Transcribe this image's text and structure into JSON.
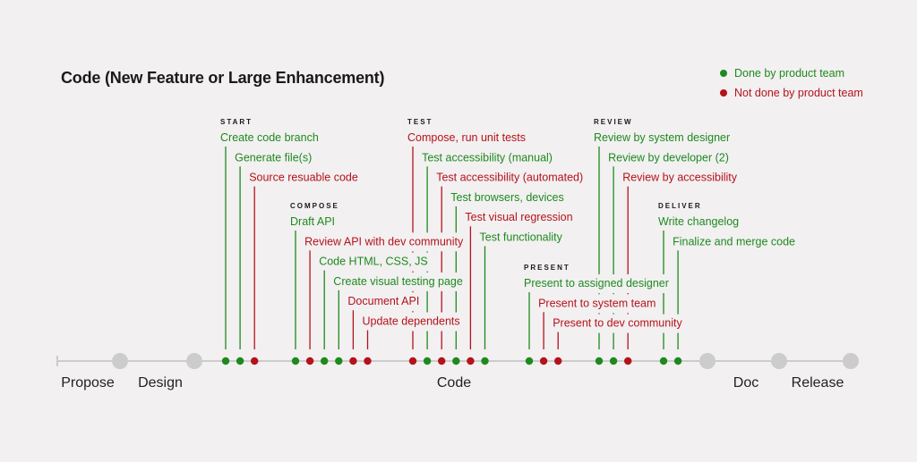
{
  "title": "Code (New Feature or Large Enhancement)",
  "colors": {
    "done": "#1e8a1e",
    "not_done": "#b5121b",
    "stage": "#cccccc",
    "axis": "#cccccc",
    "background": "#f2f0f1"
  },
  "legend": [
    {
      "label": "Done by product team",
      "status": "done"
    },
    {
      "label": "Not done by product team",
      "status": "not_done"
    }
  ],
  "stages": [
    {
      "label": "Propose"
    },
    {
      "label": "Design"
    },
    {
      "label": "Code"
    },
    {
      "label": "Doc"
    },
    {
      "label": "Release"
    }
  ],
  "phases": [
    {
      "name": "START",
      "steps": [
        {
          "label": "Create code branch",
          "status": "done"
        },
        {
          "label": "Generate file(s)",
          "status": "done"
        },
        {
          "label": "Source resuable code",
          "status": "not_done"
        }
      ]
    },
    {
      "name": "COMPOSE",
      "steps": [
        {
          "label": "Draft API",
          "status": "done"
        },
        {
          "label": "Review API with dev community",
          "status": "not_done"
        },
        {
          "label": "Code HTML, CSS, JS",
          "status": "done"
        },
        {
          "label": "Create visual testing page",
          "status": "done"
        },
        {
          "label": "Document API",
          "status": "not_done"
        },
        {
          "label": "Update dependents",
          "status": "not_done"
        }
      ]
    },
    {
      "name": "TEST",
      "steps": [
        {
          "label": "Compose, run unit tests",
          "status": "not_done"
        },
        {
          "label": "Test accessibility (manual)",
          "status": "done"
        },
        {
          "label": "Test accessibility (automated)",
          "status": "not_done"
        },
        {
          "label": "Test browsers, devices",
          "status": "done"
        },
        {
          "label": "Test visual regression",
          "status": "not_done"
        },
        {
          "label": "Test functionality",
          "status": "done"
        }
      ]
    },
    {
      "name": "PRESENT",
      "steps": [
        {
          "label": "Present to assigned designer",
          "status": "done"
        },
        {
          "label": "Present to system team",
          "status": "not_done"
        },
        {
          "label": "Present to dev community",
          "status": "not_done"
        }
      ]
    },
    {
      "name": "REVIEW",
      "steps": [
        {
          "label": "Review by system designer",
          "status": "done"
        },
        {
          "label": "Review by developer (2)",
          "status": "done"
        },
        {
          "label": "Review by accessibility",
          "status": "not_done"
        }
      ]
    },
    {
      "name": "DELIVER",
      "steps": [
        {
          "label": "Write changelog",
          "status": "done"
        },
        {
          "label": "Finalize and merge code",
          "status": "done"
        }
      ]
    }
  ]
}
